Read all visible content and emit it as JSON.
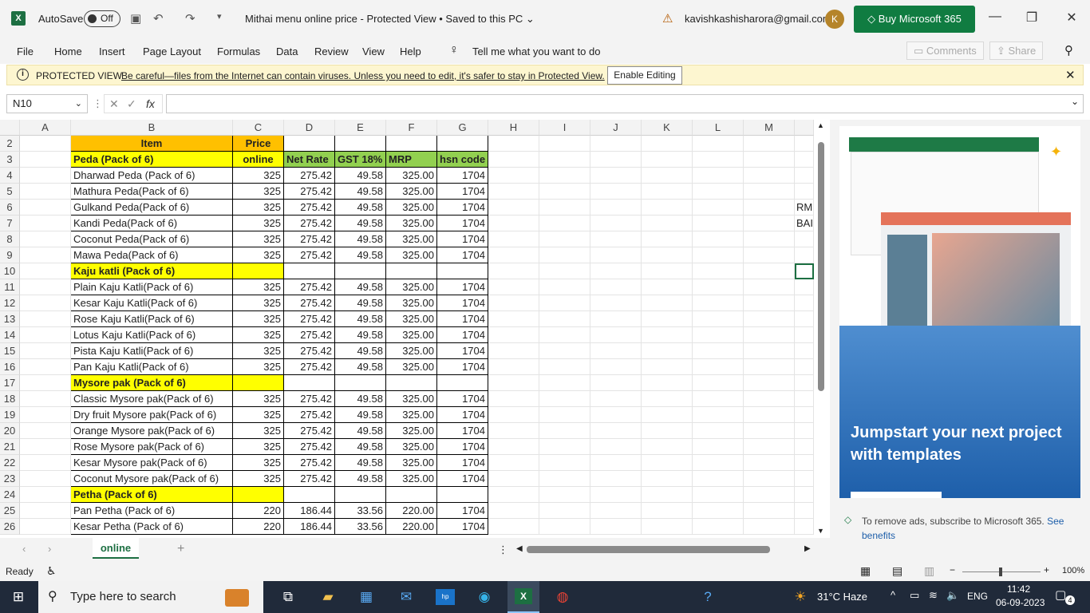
{
  "titlebar": {
    "autosave_label": "AutoSave",
    "autosave_state": "Off",
    "doc_title": "Mithai menu online price  -  Protected View • Saved to this PC ⌄",
    "account": "kavishkashisharora@gmail.com",
    "avatar_letter": "K",
    "buy_label": "Buy Microsoft 365"
  },
  "menu": {
    "items": [
      "File",
      "Home",
      "Insert",
      "Page Layout",
      "Formulas",
      "Data",
      "Review",
      "View",
      "Help"
    ],
    "tellme": "Tell me what you want to do",
    "comments": "Comments",
    "share": "Share"
  },
  "protected": {
    "title": "PROTECTED VIEW",
    "message": "Be careful—files from the Internet can contain viruses. Unless you need to edit, it's safer to stay in Protected View.",
    "button": "Enable Editing"
  },
  "formula": {
    "namebox": "N10",
    "value": ""
  },
  "grid": {
    "columns": [
      "A",
      "B",
      "C",
      "D",
      "E",
      "F",
      "G",
      "H",
      "I",
      "J",
      "K",
      "L",
      "M"
    ],
    "row_numbers": [
      "2",
      "3",
      "4",
      "5",
      "6",
      "7",
      "8",
      "9",
      "10",
      "11",
      "12",
      "13",
      "14",
      "15",
      "16",
      "17",
      "18",
      "19",
      "20",
      "21",
      "22",
      "23",
      "24",
      "25",
      "26"
    ],
    "header_item": "Item",
    "header_price": "Price",
    "rows": [
      {
        "kind": "cat",
        "item": "Peda (Pack of 6)",
        "c": "online",
        "d": "Net Rate",
        "e": "GST 18%",
        "f": "MRP",
        "g": "hsn code"
      },
      {
        "kind": "data",
        "item": "Dharwad Peda (Pack of 6)",
        "c": "325",
        "d": "275.42",
        "e": "49.58",
        "f": "325.00",
        "g": "1704"
      },
      {
        "kind": "data",
        "item": "Mathura Peda(Pack of 6)",
        "c": "325",
        "d": "275.42",
        "e": "49.58",
        "f": "325.00",
        "g": "1704"
      },
      {
        "kind": "data",
        "item": "Gulkand Peda(Pack of 6)",
        "c": "325",
        "d": "275.42",
        "e": "49.58",
        "f": "325.00",
        "g": "1704"
      },
      {
        "kind": "data",
        "item": "Kandi Peda(Pack of 6)",
        "c": "325",
        "d": "275.42",
        "e": "49.58",
        "f": "325.00",
        "g": "1704"
      },
      {
        "kind": "data",
        "item": "Coconut Peda(Pack of 6)",
        "c": "325",
        "d": "275.42",
        "e": "49.58",
        "f": "325.00",
        "g": "1704"
      },
      {
        "kind": "data",
        "item": "Mawa Peda(Pack of 6)",
        "c": "325",
        "d": "275.42",
        "e": "49.58",
        "f": "325.00",
        "g": "1704"
      },
      {
        "kind": "cat2",
        "item": "Kaju katli (Pack of 6)"
      },
      {
        "kind": "data",
        "item": "Plain Kaju Katli(Pack of 6)",
        "c": "325",
        "d": "275.42",
        "e": "49.58",
        "f": "325.00",
        "g": "1704"
      },
      {
        "kind": "data",
        "item": "Kesar Kaju Katli(Pack of 6)",
        "c": "325",
        "d": "275.42",
        "e": "49.58",
        "f": "325.00",
        "g": "1704"
      },
      {
        "kind": "data",
        "item": "Rose Kaju Katli(Pack of 6)",
        "c": "325",
        "d": "275.42",
        "e": "49.58",
        "f": "325.00",
        "g": "1704"
      },
      {
        "kind": "data",
        "item": "Lotus Kaju Katli(Pack of 6)",
        "c": "325",
        "d": "275.42",
        "e": "49.58",
        "f": "325.00",
        "g": "1704"
      },
      {
        "kind": "data",
        "item": "Pista Kaju Katli(Pack of 6)",
        "c": "325",
        "d": "275.42",
        "e": "49.58",
        "f": "325.00",
        "g": "1704"
      },
      {
        "kind": "data",
        "item": "Pan Kaju Katli(Pack of 6)",
        "c": "325",
        "d": "275.42",
        "e": "49.58",
        "f": "325.00",
        "g": "1704"
      },
      {
        "kind": "cat2",
        "item": "Mysore pak (Pack of 6)"
      },
      {
        "kind": "data",
        "item": "Classic Mysore pak(Pack of 6)",
        "c": "325",
        "d": "275.42",
        "e": "49.58",
        "f": "325.00",
        "g": "1704"
      },
      {
        "kind": "data",
        "item": "Dry fruit Mysore pak(Pack of 6)",
        "c": "325",
        "d": "275.42",
        "e": "49.58",
        "f": "325.00",
        "g": "1704"
      },
      {
        "kind": "data",
        "item": "Orange Mysore pak(Pack of 6)",
        "c": "325",
        "d": "275.42",
        "e": "49.58",
        "f": "325.00",
        "g": "1704"
      },
      {
        "kind": "data",
        "item": "Rose Mysore pak(Pack of 6)",
        "c": "325",
        "d": "275.42",
        "e": "49.58",
        "f": "325.00",
        "g": "1704"
      },
      {
        "kind": "data",
        "item": "Kesar Mysore pak(Pack of 6)",
        "c": "325",
        "d": "275.42",
        "e": "49.58",
        "f": "325.00",
        "g": "1704"
      },
      {
        "kind": "data",
        "item": "Coconut Mysore pak(Pack of 6)",
        "c": "325",
        "d": "275.42",
        "e": "49.58",
        "f": "325.00",
        "g": "1704"
      },
      {
        "kind": "cat2",
        "item": "Petha (Pack of 6)"
      },
      {
        "kind": "data",
        "item": "Pan Petha (Pack of 6)",
        "c": "220",
        "d": "186.44",
        "e": "33.56",
        "f": "220.00",
        "g": "1704"
      },
      {
        "kind": "data",
        "item": "Kesar Petha (Pack of 6)",
        "c": "220",
        "d": "186.44",
        "e": "33.56",
        "f": "220.00",
        "g": "1704"
      }
    ],
    "m_notes": {
      "row6": "RM",
      "row7": "BAI"
    }
  },
  "sheets": {
    "active": "online",
    "add": "+"
  },
  "status": {
    "ready": "Ready",
    "zoom": "100%"
  },
  "sidepane": {
    "headline": "Jumpstart your next project with templates",
    "note": "To remove ads, subscribe to Microsoft 365.",
    "link": "See benefits"
  },
  "taskbar": {
    "search": "Type here to search",
    "weather": "31°C  Haze",
    "lang": "ENG",
    "time": "11:42",
    "date": "06-09-2023",
    "notif": "4"
  }
}
